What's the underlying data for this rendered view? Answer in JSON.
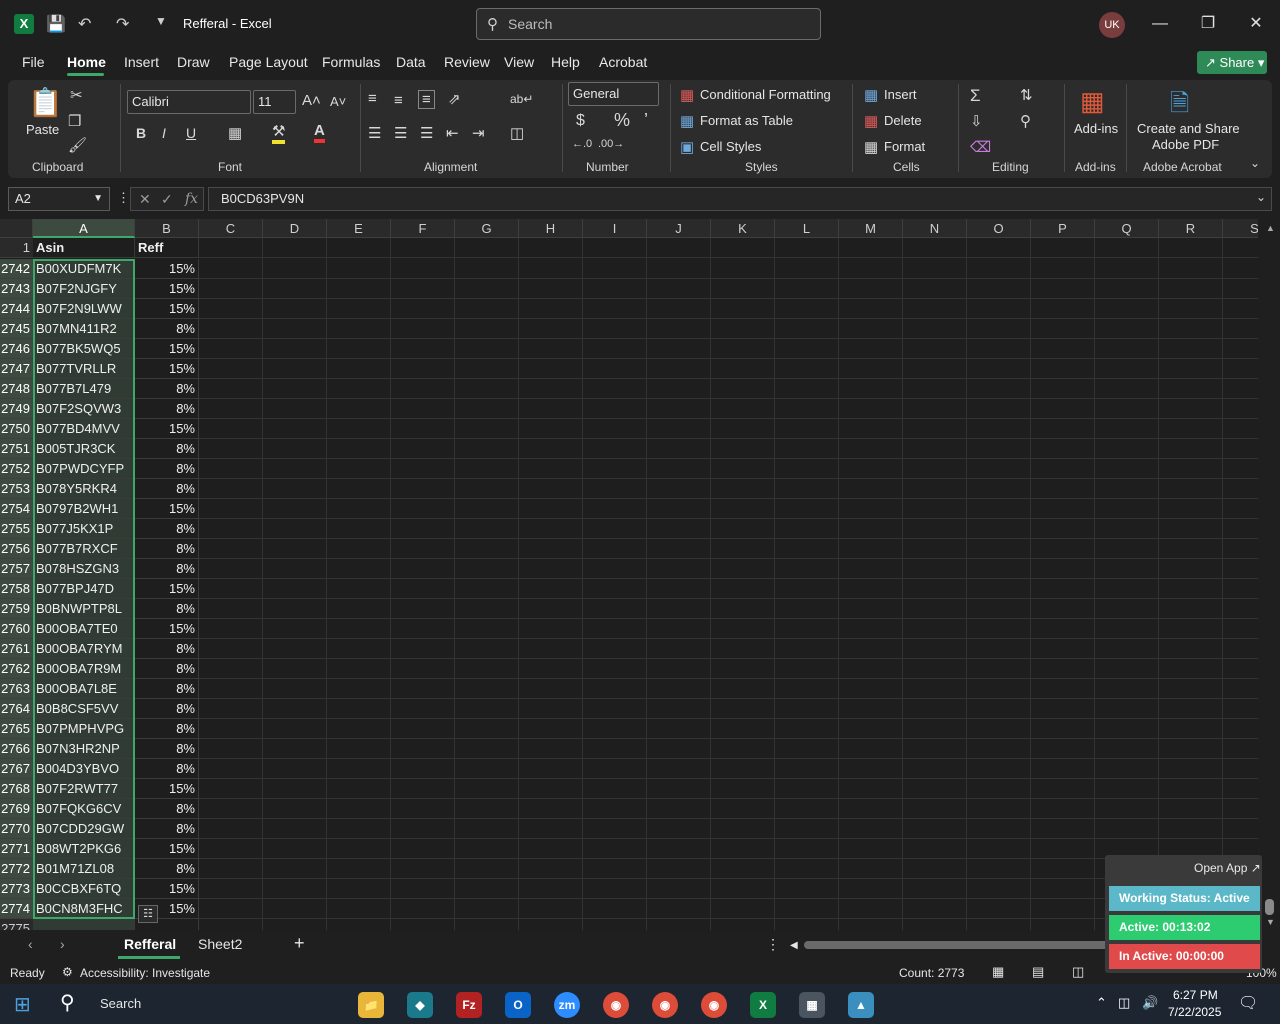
{
  "window": {
    "title": "Refferal - Excel",
    "search_placeholder": "Search",
    "user_initials": "UK"
  },
  "menu": {
    "items": [
      "File",
      "Home",
      "Insert",
      "Draw",
      "Page Layout",
      "Formulas",
      "Data",
      "Review",
      "View",
      "Help",
      "Acrobat"
    ],
    "share_label": "Share"
  },
  "ribbon": {
    "clipboard": {
      "paste": "Paste",
      "label": "Clipboard"
    },
    "font": {
      "name": "Calibri",
      "size": "11",
      "label": "Font"
    },
    "alignment": {
      "label": "Alignment"
    },
    "number": {
      "format": "General",
      "label": "Number",
      "currency": "$",
      "percent": "%"
    },
    "styles": {
      "conditional": "Conditional Formatting",
      "table": "Format as Table",
      "cell": "Cell Styles",
      "label": "Styles"
    },
    "cells": {
      "insert": "Insert",
      "delete": "Delete",
      "format": "Format",
      "label": "Cells"
    },
    "editing": {
      "label": "Editing"
    },
    "addins": {
      "button": "Add-ins",
      "label": "Add-ins"
    },
    "acrobat": {
      "line1": "Create and Share",
      "line2": "Adobe PDF",
      "label": "Adobe Acrobat"
    }
  },
  "formula_bar": {
    "name_box": "A2",
    "fx": "fx",
    "value": "B0CD63PV9N"
  },
  "columns": [
    "A",
    "B",
    "C",
    "D",
    "E",
    "F",
    "G",
    "H",
    "I",
    "J",
    "K",
    "L",
    "M",
    "N",
    "O",
    "P",
    "Q",
    "R",
    "S"
  ],
  "header_row": {
    "row": "1",
    "a": "Asin",
    "b": "Reff"
  },
  "rows": [
    {
      "n": "2742",
      "a": "B00XUDFM7K",
      "b": "15%"
    },
    {
      "n": "2743",
      "a": "B07F2NJGFY",
      "b": "15%"
    },
    {
      "n": "2744",
      "a": "B07F2N9LWW",
      "b": "15%"
    },
    {
      "n": "2745",
      "a": "B07MN411R2",
      "b": "8%"
    },
    {
      "n": "2746",
      "a": "B077BK5WQ5",
      "b": "15%"
    },
    {
      "n": "2747",
      "a": "B077TVRLLR",
      "b": "15%"
    },
    {
      "n": "2748",
      "a": "B077B7L479",
      "b": "8%"
    },
    {
      "n": "2749",
      "a": "B07F2SQVW3",
      "b": "8%"
    },
    {
      "n": "2750",
      "a": "B077BD4MVV",
      "b": "15%"
    },
    {
      "n": "2751",
      "a": "B005TJR3CK",
      "b": "8%"
    },
    {
      "n": "2752",
      "a": "B07PWDCYFP",
      "b": "8%"
    },
    {
      "n": "2753",
      "a": "B078Y5RKR4",
      "b": "8%"
    },
    {
      "n": "2754",
      "a": "B0797B2WH1",
      "b": "15%"
    },
    {
      "n": "2755",
      "a": "B077J5KX1P",
      "b": "8%"
    },
    {
      "n": "2756",
      "a": "B077B7RXCF",
      "b": "8%"
    },
    {
      "n": "2757",
      "a": "B078HSZGN3",
      "b": "8%"
    },
    {
      "n": "2758",
      "a": "B077BPJ47D",
      "b": "15%"
    },
    {
      "n": "2759",
      "a": "B0BNWPTP8L",
      "b": "8%"
    },
    {
      "n": "2760",
      "a": "B00OBA7TE0",
      "b": "15%"
    },
    {
      "n": "2761",
      "a": "B00OBA7RYM",
      "b": "8%"
    },
    {
      "n": "2762",
      "a": "B00OBA7R9M",
      "b": "8%"
    },
    {
      "n": "2763",
      "a": "B00OBA7L8E",
      "b": "8%"
    },
    {
      "n": "2764",
      "a": "B0B8CSF5VV",
      "b": "8%"
    },
    {
      "n": "2765",
      "a": "B07PMPHVPG",
      "b": "8%"
    },
    {
      "n": "2766",
      "a": "B07N3HR2NP",
      "b": "8%"
    },
    {
      "n": "2767",
      "a": "B004D3YBVO",
      "b": "8%"
    },
    {
      "n": "2768",
      "a": "B07F2RWT77",
      "b": "15%"
    },
    {
      "n": "2769",
      "a": "B07FQKG6CV",
      "b": "8%"
    },
    {
      "n": "2770",
      "a": "B07CDD29GW",
      "b": "8%"
    },
    {
      "n": "2771",
      "a": "B08WT2PKG6",
      "b": "15%"
    },
    {
      "n": "2772",
      "a": "B01M71ZL08",
      "b": "8%"
    },
    {
      "n": "2773",
      "a": "B0CCBXF6TQ",
      "b": "15%"
    },
    {
      "n": "2774",
      "a": "B0CN8M3FHC",
      "b": "15%"
    }
  ],
  "partial_row": "2775",
  "sheets": {
    "active": "Refferal",
    "other": "Sheet2"
  },
  "status": {
    "ready": "Ready",
    "accessibility": "Accessibility: Investigate",
    "count": "Count: 2773",
    "zoom": "100%"
  },
  "overlay": {
    "open_app": "Open App",
    "working": "Working Status: Active",
    "active": "Active: 00:13:02",
    "inactive": "In Active: 00:00:00"
  },
  "taskbar": {
    "search": "Search",
    "time": "6:27 PM",
    "date": "7/22/2025"
  },
  "colors": {
    "accent": "#3ea86b",
    "excel_green": "#107c41",
    "status_active": "#2ecc71",
    "status_inactive": "#e04a4a",
    "status_working": "#5bb8c8"
  }
}
